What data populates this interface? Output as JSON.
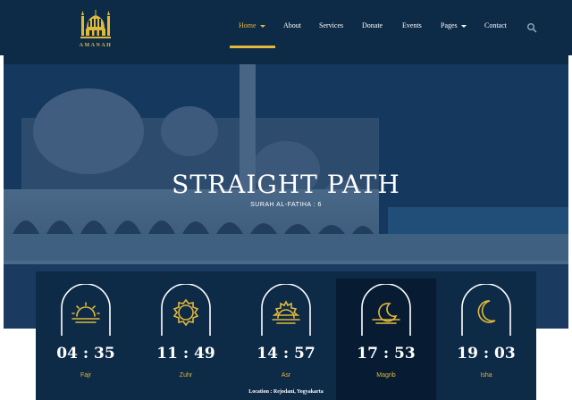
{
  "brand": {
    "logo_text": "AMANAH"
  },
  "nav": {
    "items": [
      {
        "label": "Home",
        "active": true,
        "dropdown": true
      },
      {
        "label": "About"
      },
      {
        "label": "Services"
      },
      {
        "label": "Donate"
      },
      {
        "label": "Events"
      },
      {
        "label": "Pages",
        "dropdown": true
      },
      {
        "label": "Contact"
      }
    ],
    "search_icon": "search-icon"
  },
  "hero": {
    "title": "STRAIGHT PATH",
    "subtitle": "SURAH AL-FATIHA : 6"
  },
  "prayers": [
    {
      "name": "Fajr",
      "time": "04 : 35",
      "icon": "sunrise-icon"
    },
    {
      "name": "Zuhr",
      "time": "11 : 49",
      "icon": "sun-icon"
    },
    {
      "name": "Asr",
      "time": "14 : 57",
      "icon": "sunset-icon"
    },
    {
      "name": "Magrib",
      "time": "17 : 53",
      "icon": "moon-over-water-icon",
      "active": true
    },
    {
      "name": "Isha",
      "time": "19 : 03",
      "icon": "crescent-moon-icon"
    }
  ],
  "location": "Location : Rejodani, Yogyakarta",
  "colors": {
    "navy": "#0d2a47",
    "gold": "#e0b83c",
    "active_card": "#071c33"
  }
}
